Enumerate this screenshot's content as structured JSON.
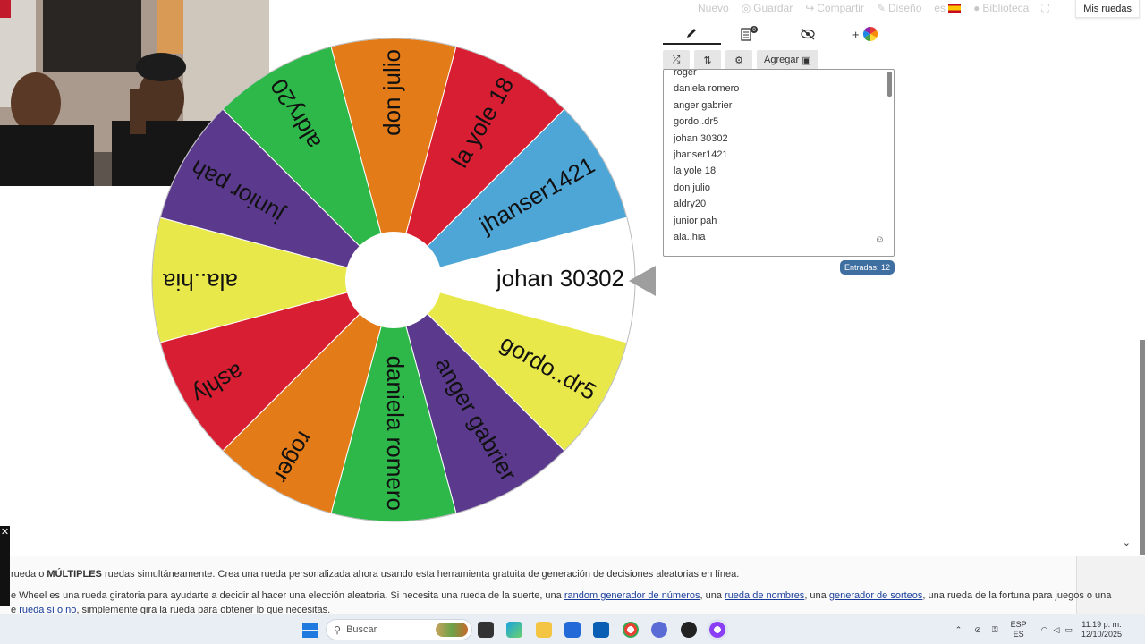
{
  "topnav": {
    "items": [
      "Nuevo",
      "Guardar",
      "Compartir",
      "Diseño",
      "es",
      "Biblioteca"
    ],
    "my_wheels": "Mis ruedas"
  },
  "wheel": {
    "segments": [
      {
        "label": "johan 30302",
        "color": "#ffffff"
      },
      {
        "label": "gordo..dr5",
        "color": "#e8e84a"
      },
      {
        "label": "anger gabrier",
        "color": "#5b3a8e"
      },
      {
        "label": "daniela romero",
        "color": "#2eb84a"
      },
      {
        "label": "roger",
        "color": "#e37b19"
      },
      {
        "label": "ashly",
        "color": "#d81e32"
      },
      {
        "label": "ala..hia",
        "color": "#e8e84a"
      },
      {
        "label": "junior pah",
        "color": "#5b3a8e"
      },
      {
        "label": "aldry20",
        "color": "#2eb84a"
      },
      {
        "label": "don julio",
        "color": "#e37b19"
      },
      {
        "label": "la yole 18",
        "color": "#d81e32"
      },
      {
        "label": "jhanser1421",
        "color": "#4ea6d6"
      }
    ]
  },
  "panel": {
    "tabs": [
      "pencil-icon",
      "clipboard-icon",
      "eye-slash-icon",
      "add-wheel-icon"
    ],
    "toolbar": {
      "add_label": "Agregar"
    },
    "entries": [
      "roger",
      "daniela romero",
      "anger gabrier",
      "gordo..dr5",
      "johan 30302",
      "jhanser1421",
      "la yole 18",
      "don julio",
      "aldry20",
      "junior pah",
      "ala..hia"
    ],
    "count": "Entradas: 12"
  },
  "info": {
    "line1_pre": "rueda o",
    "line1_bold": "MÚLTIPLES",
    "line1_post": "ruedas simultáneamente. Crea una rueda personalizada ahora usando esta herramienta gratuita de generación de decisiones aleatorias en línea.",
    "line2_pre": "e Wheel es una rueda giratoria para ayudarte a decidir al hacer una elección aleatoria. Si necesita una rueda de la suerte, una",
    "link1": "random generador de números",
    "line2_mid1": ", una",
    "link2": "rueda de nombres",
    "line2_mid2": ", una",
    "link3": "generador de sorteos",
    "line2_post": ", una rueda de la fortuna para juegos o una",
    "line3_pre": "e",
    "link4": "rueda sí o no",
    "line3_post": ", simplemente gira la rueda para obtener lo que necesitas."
  },
  "taskbar": {
    "search_placeholder": "Buscar",
    "lang_top": "ESP",
    "lang_bottom": "ES",
    "time": "11:19 p. m.",
    "date": "12/10/2025"
  }
}
